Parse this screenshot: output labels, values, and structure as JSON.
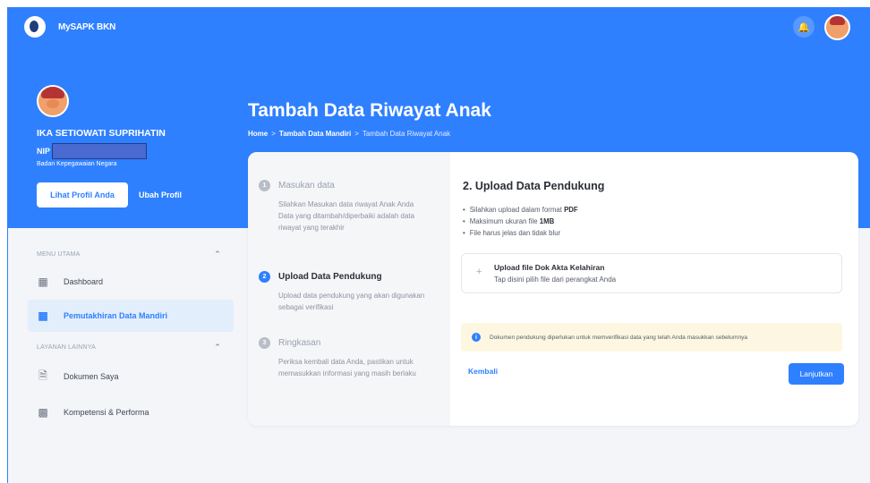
{
  "app": {
    "name": "MySAPK BKN"
  },
  "header": {
    "bell_icon": "bell-icon",
    "avatar_icon": "user-avatar"
  },
  "profile": {
    "name": "IKA SETIOWATI SUPRIHATIN",
    "nip_label": "NIP",
    "agency": "Badan Kepegawaian Negara",
    "view_profile_label": "Lihat Profil Anda",
    "edit_profile_label": "Ubah Profil"
  },
  "page": {
    "title": "Tambah Data Riwayat Anak",
    "breadcrumb": [
      "Home",
      ">",
      "Tambah Data Mandiri",
      ">",
      "Tambah Data Riwayat Anak"
    ]
  },
  "sidebar": {
    "sections": [
      {
        "title": "MENU UTAMA",
        "items": [
          {
            "label": "Dashboard",
            "icon": "dashboard-icon"
          },
          {
            "label": "Pemutakhiran Data Mandiri",
            "icon": "update-data-icon"
          }
        ]
      },
      {
        "title": "LAYANAN LAINNYA",
        "items": [
          {
            "label": "Dokumen Saya",
            "icon": "document-icon"
          },
          {
            "label": "Kompetensi & Performa",
            "icon": "grid-icon"
          }
        ]
      }
    ]
  },
  "steps": [
    {
      "num": "1",
      "title": "Masukan data",
      "desc": "Silahkan Masukan data riwayat Anak Anda\nData yang ditambah/diperbaiki adalah data riwayat yang terakhir"
    },
    {
      "num": "2",
      "title": "Upload Data Pendukung",
      "desc": "Upload data pendukung yang akan digunakan sebagai verifikasi"
    },
    {
      "num": "3",
      "title": "Ringkasan",
      "desc": "Periksa kembali data Anda, pastikan untuk memasukkan informasi yang masih berlaku"
    }
  ],
  "content": {
    "title": "2. Upload Data Pendukung",
    "requirements": [
      {
        "text": "Silahkan upload dalam format ",
        "bold": "PDF"
      },
      {
        "text": "Maksimum ukuran file ",
        "bold": "1MB"
      },
      {
        "text": "File harus jelas dan tidak blur",
        "bold": ""
      }
    ],
    "upload": {
      "plus": "+",
      "title": "Upload file Dok Akta Kelahiran",
      "subtitle": "Tap disini pilih file dari perangkat Anda"
    },
    "notice": "Dokumen pendukung diperlukan untuk memverifikasi data yang telah Anda masukkan sebelumnya",
    "back_label": "Kembali",
    "next_label": "Lanjutkan"
  },
  "colors": {
    "primary": "#2f80ff",
    "notice_bg": "#fdf7e1"
  }
}
